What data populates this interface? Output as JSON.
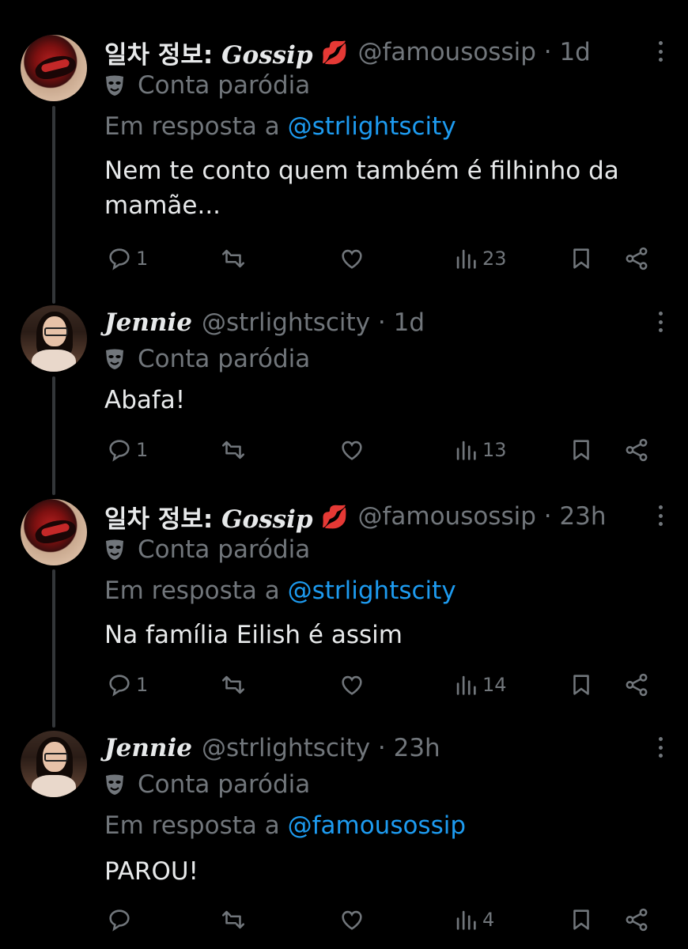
{
  "tweets": [
    {
      "account": "gossip",
      "name": "일차 정보:",
      "name_script": "Gossip",
      "emoji": "💋",
      "handle_meta": "@famousossip · 1d",
      "parody_label": "Conta paródia",
      "reply_prefix": "Em resposta a",
      "reply_handle": "@strlightscity",
      "text": "Nem te conto quem também é filhinho da mamãe...",
      "replies": "1",
      "retweets": "",
      "likes": "",
      "views": "23",
      "avatar_icon": "avatar-lips-icon"
    },
    {
      "account": "jennie",
      "name": "",
      "name_script": "Jennie",
      "emoji": "",
      "handle_meta": "@strlightscity · 1d",
      "parody_label": "Conta paródia",
      "reply_prefix": "",
      "reply_handle": "",
      "text": "Abafa!",
      "replies": "1",
      "retweets": "",
      "likes": "",
      "views": "13",
      "avatar_icon": "avatar-photo-icon"
    },
    {
      "account": "gossip",
      "name": "일차 정보:",
      "name_script": "Gossip",
      "emoji": "💋",
      "handle_meta": "@famousossip · 23h",
      "parody_label": "Conta paródia",
      "reply_prefix": "Em resposta a",
      "reply_handle": "@strlightscity",
      "text": "Na família Eilish é assim",
      "replies": "1",
      "retweets": "",
      "likes": "",
      "views": "14",
      "avatar_icon": "avatar-lips-icon"
    },
    {
      "account": "jennie",
      "name": "",
      "name_script": "Jennie",
      "emoji": "",
      "handle_meta": "@strlightscity · 23h",
      "parody_label": "Conta paródia",
      "reply_prefix": "Em resposta a",
      "reply_handle": "@famousossip",
      "text": "PAROU!",
      "replies": "",
      "retweets": "",
      "likes": "",
      "views": "4",
      "avatar_icon": "avatar-photo-icon"
    }
  ],
  "colors": {
    "background": "#000000",
    "text": "#e7e9ea",
    "muted": "#71767b",
    "link": "#1d9bf0",
    "thread_line": "#333639"
  },
  "icons": [
    "reply-icon",
    "retweet-icon",
    "like-icon",
    "views-icon",
    "bookmark-icon",
    "share-icon",
    "more-icon",
    "parody-mask-icon"
  ]
}
